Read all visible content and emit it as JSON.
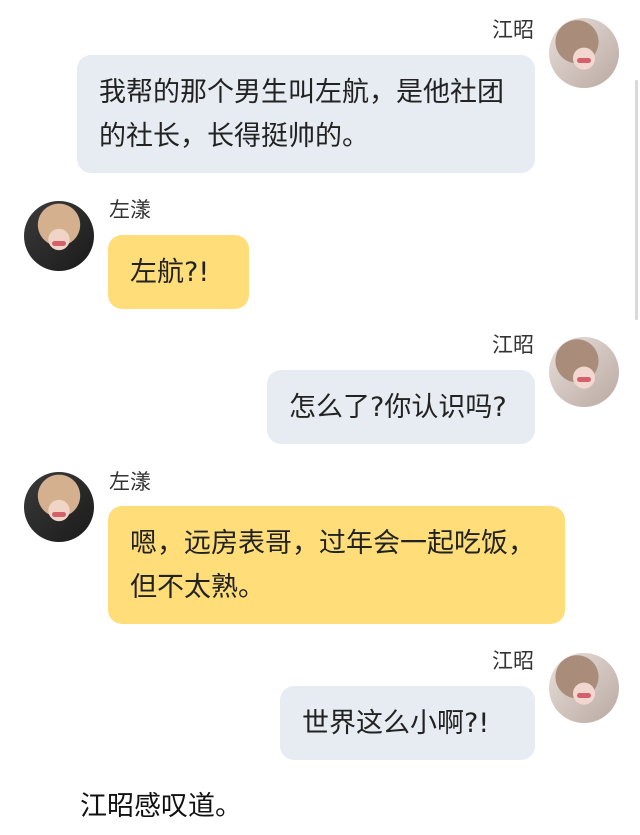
{
  "messages": [
    {
      "sender": "江昭",
      "side": "right",
      "avatar_icon": "avatar-icon-jiangzhao",
      "text": "我帮的那个男生叫左航，是他社团的社长，长得挺帅的。"
    },
    {
      "sender": "左漾",
      "side": "left",
      "avatar_icon": "avatar-icon-zuoyang",
      "text": "左航?!"
    },
    {
      "sender": "江昭",
      "side": "right",
      "avatar_icon": "avatar-icon-jiangzhao",
      "text": "怎么了?你认识吗?"
    },
    {
      "sender": "左漾",
      "side": "left",
      "avatar_icon": "avatar-icon-zuoyang",
      "text": "嗯，远房表哥，过年会一起吃饭，但不太熟。"
    },
    {
      "sender": "江昭",
      "side": "right",
      "avatar_icon": "avatar-icon-jiangzhao",
      "text": "世界这么小啊?!"
    }
  ],
  "narration": "江昭感叹道。",
  "colors": {
    "right_bubble": "#e7ecf2",
    "left_bubble": "#ffde7a",
    "text": "#222222",
    "background": "#ffffff"
  }
}
